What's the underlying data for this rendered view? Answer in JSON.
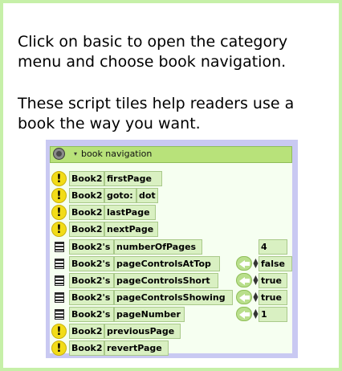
{
  "instructions": {
    "para1": "Click on basic to open the category menu and choose book navigation.",
    "para2": "These script tiles help readers use a book the way you want."
  },
  "category": {
    "label": "book navigation",
    "icon": "category-menu-icon"
  },
  "tiles": {
    "row1": {
      "obj": "Book2",
      "cmd": "firstPage"
    },
    "row2": {
      "obj": "Book2",
      "cmd": "goto:",
      "arg": "dot"
    },
    "row3": {
      "obj": "Book2",
      "cmd": "lastPage"
    },
    "row4": {
      "obj": "Book2",
      "cmd": "nextPage"
    },
    "row5": {
      "obj": "Book2's",
      "prop": "numberOfPages",
      "value": "4"
    },
    "row6": {
      "obj": "Book2's",
      "prop": "pageControlsAtTop",
      "value": "false"
    },
    "row7": {
      "obj": "Book2's",
      "prop": "pageControlsShort",
      "value": "true"
    },
    "row8": {
      "obj": "Book2's",
      "prop": "pageControlsShowing",
      "value": "true"
    },
    "row9": {
      "obj": "Book2's",
      "prop": "pageNumber",
      "value": "1"
    },
    "row10": {
      "obj": "Book2",
      "cmd": "previousPage"
    },
    "row11": {
      "obj": "Book2",
      "cmd": "revertPage"
    }
  },
  "colors": {
    "frame_border": "#c6f0a8",
    "panel_bg": "#c9c9f2",
    "header_bg": "#b8e27a",
    "tile_bg": "#d9f0c2",
    "bang_icon": "#f2dc18"
  }
}
